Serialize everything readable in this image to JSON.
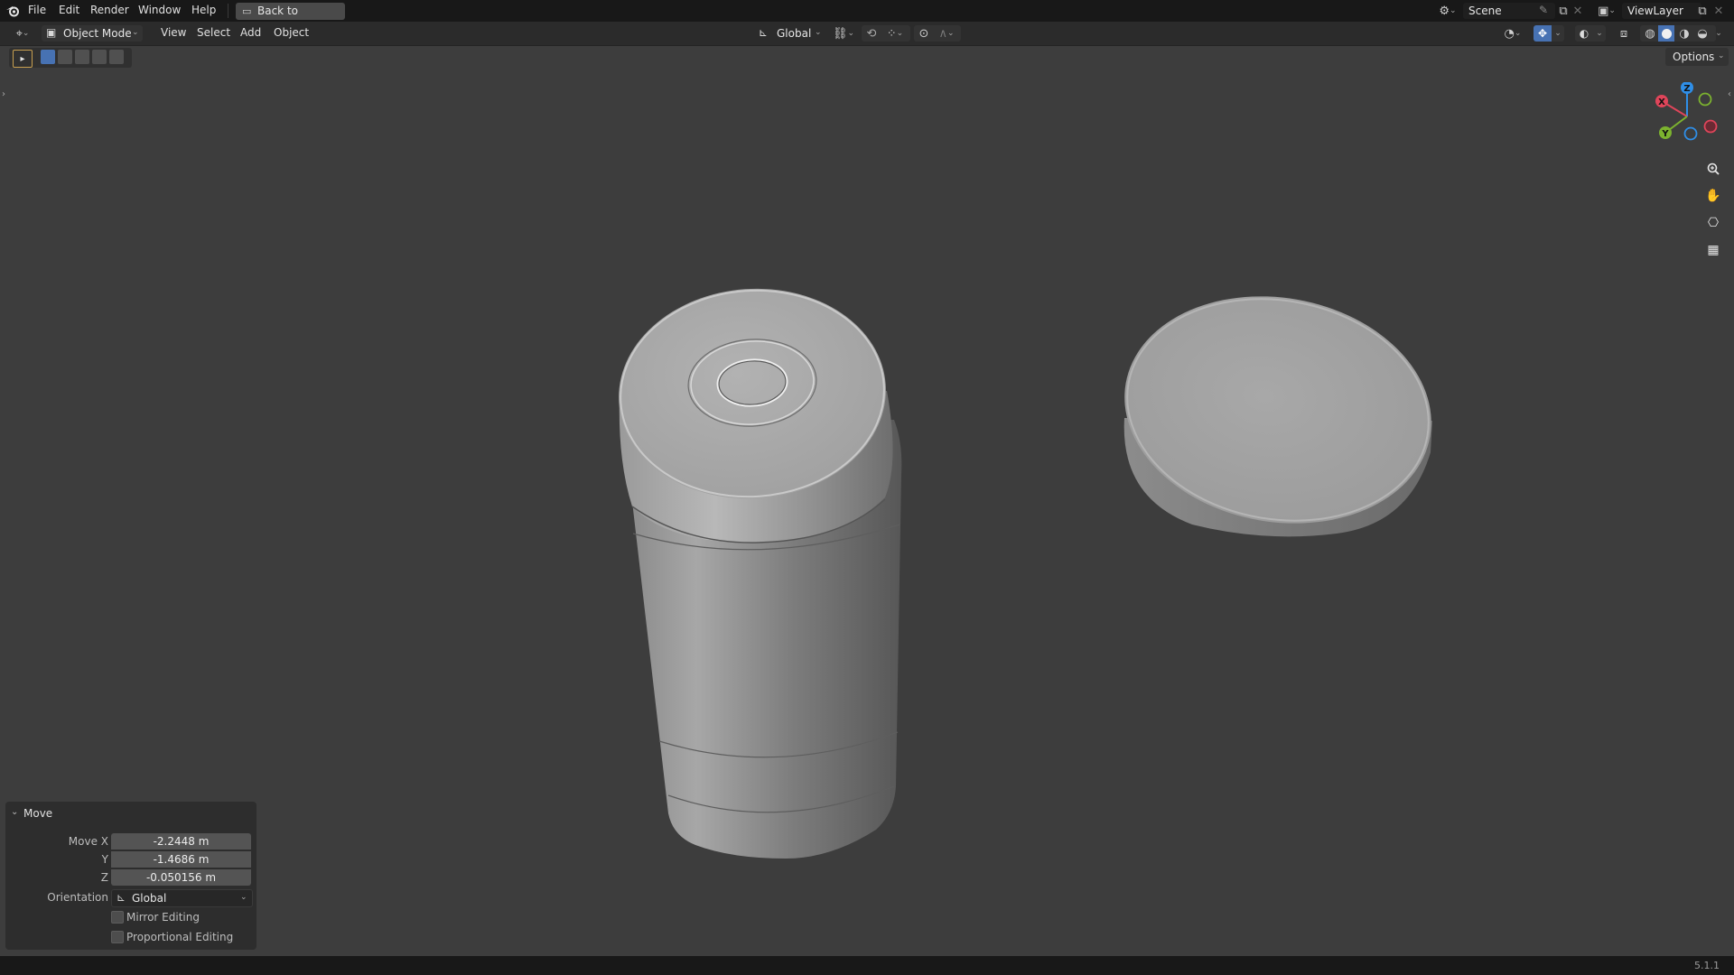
{
  "topbar": {
    "menus": [
      "File",
      "Edit",
      "Render",
      "Window",
      "Help"
    ],
    "back_button": "Back to Previous",
    "scene_name": "Scene",
    "view_layer": "ViewLayer"
  },
  "header": {
    "mode": "Object Mode",
    "menus": [
      "View",
      "Select",
      "Add",
      "Object"
    ],
    "transform_orientation": "Global",
    "options_label": "Options"
  },
  "gizmo": {
    "axes": [
      "X",
      "Y",
      "Z"
    ],
    "colors": {
      "x": "#e0455a",
      "y": "#7cb32f",
      "z": "#2f8fe8"
    }
  },
  "operator_panel": {
    "title": "Move",
    "fields": [
      {
        "label": "Move X",
        "value": "-2.2448 m"
      },
      {
        "label": "Y",
        "value": "-1.4686 m"
      },
      {
        "label": "Z",
        "value": "-0.050156 m"
      }
    ],
    "orientation_label": "Orientation",
    "orientation_value": "Global",
    "mirror_editing": "Mirror Editing",
    "proportional_editing": "Proportional Editing"
  },
  "status": {
    "version": "5.1.1"
  },
  "colors": {
    "accent": "#4772b3",
    "viewport_bg": "#3d3d3d",
    "header_bg": "#2b2b2b"
  }
}
